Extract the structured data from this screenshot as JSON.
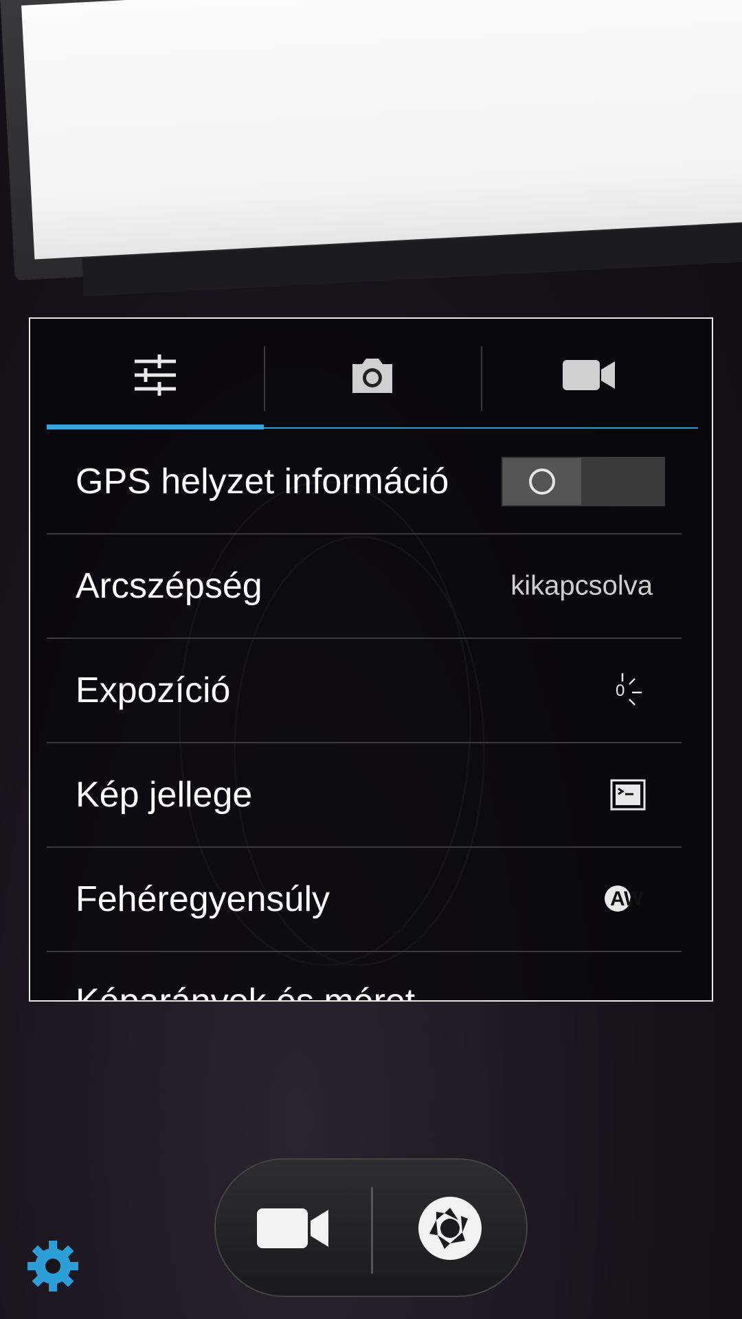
{
  "tabs": [
    {
      "name": "general-settings",
      "icon": "sliders-icon",
      "active": true
    },
    {
      "name": "photo-settings",
      "icon": "camera-icon",
      "active": false
    },
    {
      "name": "video-settings",
      "icon": "video-camera-icon",
      "active": false
    }
  ],
  "settings": {
    "gps": {
      "label": "GPS helyzet információ",
      "enabled": false
    },
    "beauty": {
      "label": "Arcszépség",
      "value": "kikapcsolva"
    },
    "exposure": {
      "label": "Expozíció",
      "value": "0"
    },
    "scene": {
      "label": "Kép jellege",
      "icon": "scene-mode-icon"
    },
    "white_balance": {
      "label": "Fehéregyensúly",
      "value": "AW"
    },
    "next_item": {
      "label": "Képarányok és méret"
    }
  },
  "controls": {
    "video_icon": "video-camera-icon",
    "shutter_icon": "shutter-icon",
    "settings_icon": "gear-icon"
  },
  "colors": {
    "accent": "#33a6e0"
  }
}
